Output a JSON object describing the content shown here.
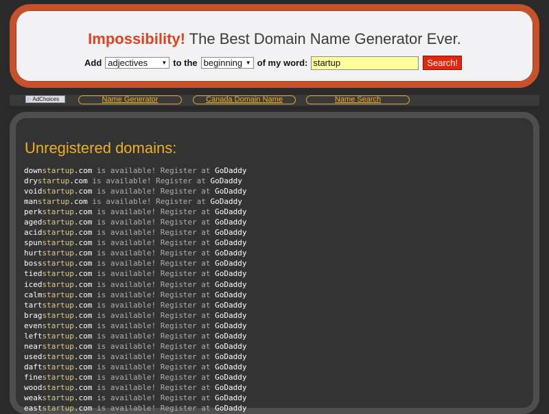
{
  "header": {
    "brand": "Impossibility!",
    "tagline": " The Best Domain Name Generator Ever.",
    "add_label": "Add",
    "to_the_label": "to the",
    "of_my_word_label": "of my word:",
    "type_select_value": "adjectives",
    "position_select_value": "beginning",
    "word_value": "startup",
    "search_label": "Search!"
  },
  "navbar": {
    "adchoices": "AdChoices",
    "links": [
      "Name Generator",
      "Canada Domain Name",
      "Name Search"
    ]
  },
  "main": {
    "title": "Unregistered domains:",
    "base_word": "startup",
    "tld": ".com",
    "available_text": " is available! Register at ",
    "registrar": "GoDaddy",
    "prefixes": [
      "down",
      "dry",
      "void",
      "man",
      "perk",
      "aged",
      "acid",
      "spun",
      "hurt",
      "boss",
      "tied",
      "iced",
      "calm",
      "tart",
      "brag",
      "even",
      "left",
      "near",
      "used",
      "daft",
      "fine",
      "wood",
      "weak",
      "east"
    ]
  },
  "colors": {
    "brand_red": "#e0421e",
    "header_border": "#c8502a",
    "accent_gold": "#f0b020",
    "base_word_color": "#e3ca8a",
    "input_yellow": "#ffff99",
    "search_button": "#e0280e"
  }
}
